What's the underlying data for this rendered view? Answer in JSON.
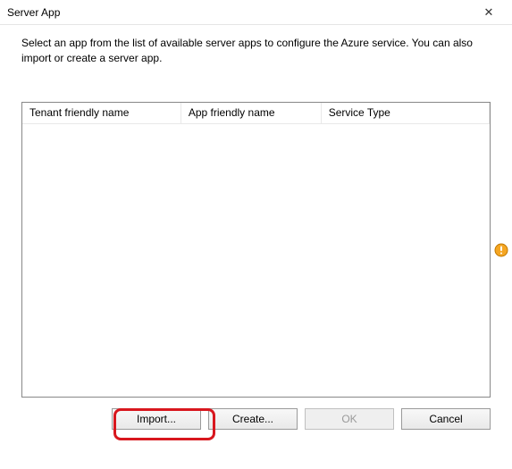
{
  "window": {
    "title": "Server App",
    "close_symbol": "✕"
  },
  "instruction": "Select an app from the list of available server apps to configure the Azure service. You can also import or create a server app.",
  "columns": {
    "tenant": "Tenant friendly name",
    "app": "App friendly name",
    "service": "Service Type"
  },
  "rows": [],
  "buttons": {
    "import": "Import...",
    "create": "Create...",
    "ok": "OK",
    "cancel": "Cancel"
  },
  "warning": {
    "name": "validation-warning-icon"
  }
}
